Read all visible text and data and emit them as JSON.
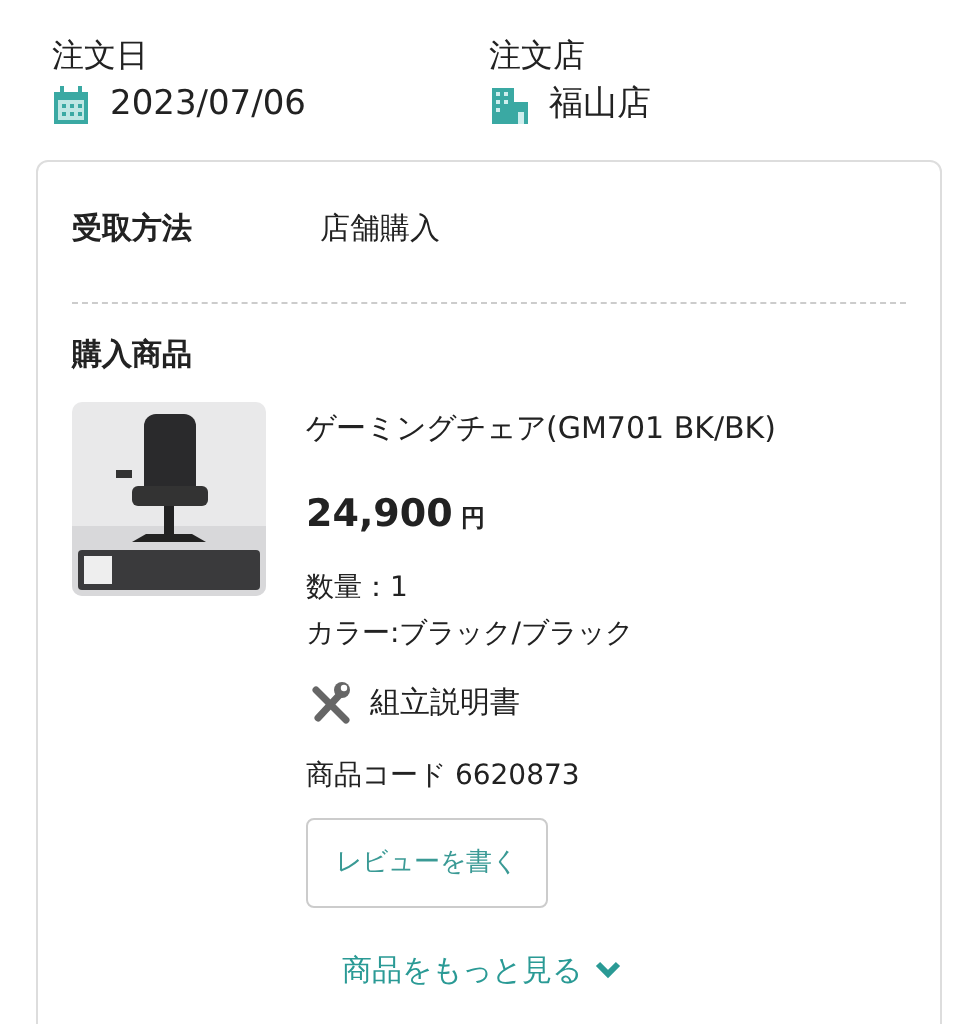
{
  "order_date": {
    "label": "注文日",
    "value": "2023/07/06"
  },
  "order_store": {
    "label": "注文店",
    "value": "福山店"
  },
  "receipt": {
    "label": "受取方法",
    "value": "店舗購入"
  },
  "purchased": {
    "label": "購入商品",
    "product": {
      "name": "ゲーミングチェア(GM701 BK/BK)",
      "price": "24,900",
      "currency": "円",
      "quantity": "数量：1",
      "variant": "カラー:ブラック/ブラック",
      "manual": "組立説明書",
      "code": "商品コード 6620873",
      "review_button": "レビューを書く"
    }
  },
  "more_link": "商品をもっと見る"
}
